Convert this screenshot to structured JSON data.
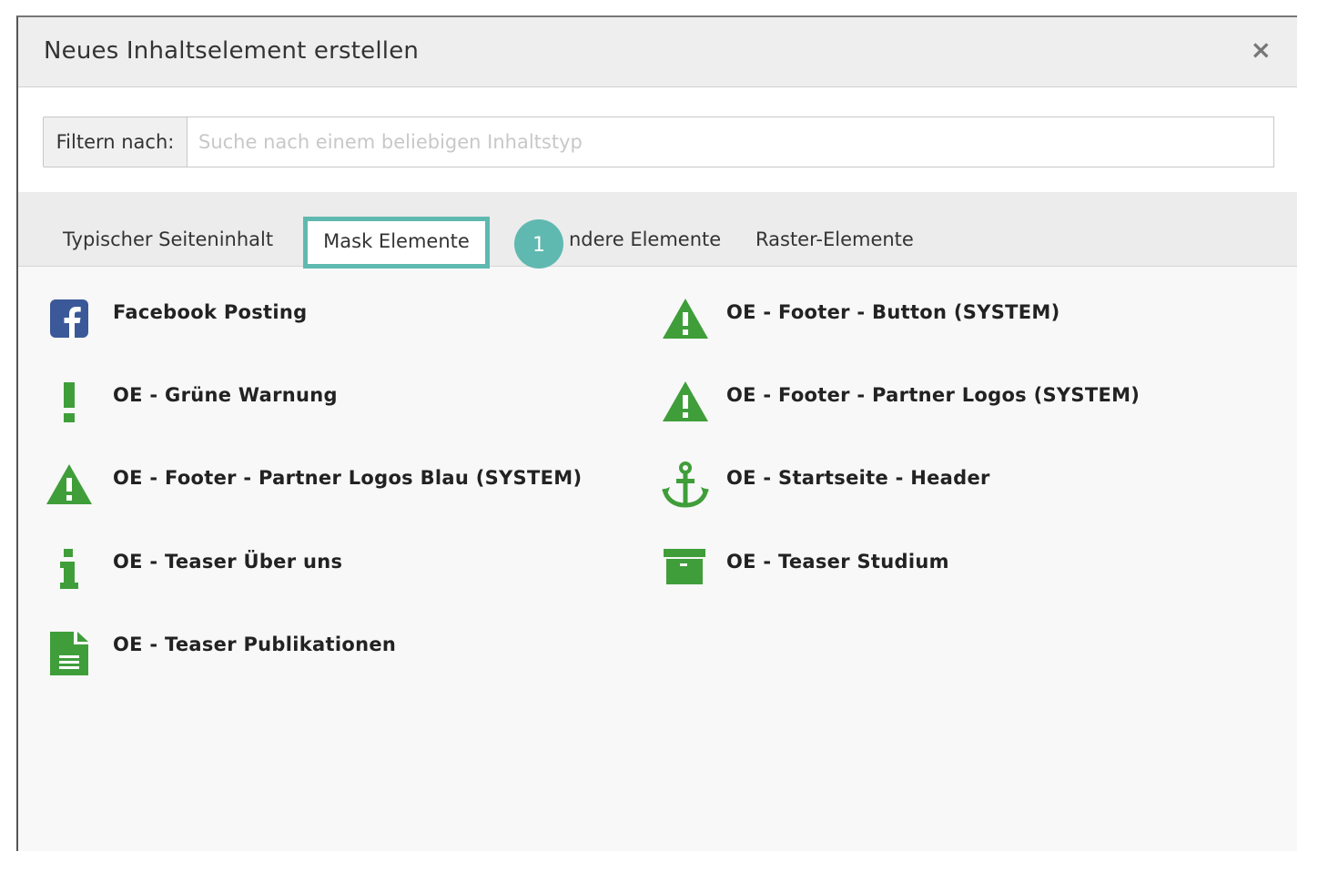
{
  "dialog": {
    "title": "Neues Inhaltselement erstellen",
    "close_label": "×"
  },
  "filter": {
    "label": "Filtern nach:",
    "placeholder": "Suche nach einem beliebigen Inhaltstyp",
    "value": ""
  },
  "tabs": [
    {
      "label": "Typischer Seiteninhalt",
      "active": false
    },
    {
      "label": "Mask Elemente",
      "active": true
    },
    {
      "label": "ndere Elemente",
      "active": false
    },
    {
      "label": "Raster-Elemente",
      "active": false
    }
  ],
  "badge": {
    "label": "1"
  },
  "colors": {
    "accent": "#5fb9b0",
    "icon_green": "#3f9e3a",
    "facebook_blue": "#3b5998"
  },
  "elements": [
    {
      "label": "Facebook Posting",
      "icon": "facebook-icon"
    },
    {
      "label": "OE - Footer - Button (SYSTEM)",
      "icon": "warning-icon"
    },
    {
      "label": "OE - Grüne Warnung",
      "icon": "exclamation-icon"
    },
    {
      "label": "OE - Footer - Partner Logos (SYSTEM)",
      "icon": "warning-icon"
    },
    {
      "label": "OE - Footer - Partner Logos Blau (SYSTEM)",
      "icon": "warning-icon"
    },
    {
      "label": "OE - Startseite - Header",
      "icon": "anchor-icon"
    },
    {
      "label": "OE - Teaser Über uns",
      "icon": "info-icon"
    },
    {
      "label": "OE - Teaser Studium",
      "icon": "archive-box-icon"
    },
    {
      "label": "OE - Teaser Publikationen",
      "icon": "document-icon"
    }
  ]
}
